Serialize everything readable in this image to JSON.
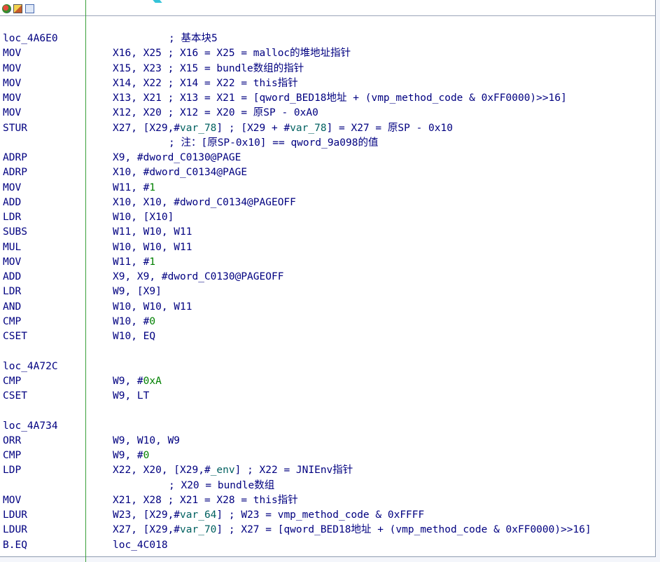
{
  "toolbar": {
    "icons": [
      "graph-view-icon",
      "edit-icon",
      "save-view-icon"
    ]
  },
  "colors": {
    "code_text": "#000080",
    "immediate": "#008000",
    "variable": "#006060",
    "separator_line": "#3aa03a"
  },
  "lines": [
    {
      "kind": "label",
      "text": "loc_4A6E0",
      "comment": "; 基本块5"
    },
    {
      "kind": "insn",
      "mnem": "MOV",
      "parts": [
        {
          "t": "X16, X25 ; X16 = X25 = malloc的堆地址指针"
        }
      ]
    },
    {
      "kind": "insn",
      "mnem": "MOV",
      "parts": [
        {
          "t": "X15, X23 ; X15 = bundle数组的指针"
        }
      ]
    },
    {
      "kind": "insn",
      "mnem": "MOV",
      "parts": [
        {
          "t": "X14, X22 ; X14 = X22 = this指针"
        }
      ]
    },
    {
      "kind": "insn",
      "mnem": "MOV",
      "parts": [
        {
          "t": "X13, X21 ; X13 = X21 = [qword_BED18地址 + (vmp_method_code & 0xFF0000)>>16]"
        }
      ]
    },
    {
      "kind": "insn",
      "mnem": "MOV",
      "parts": [
        {
          "t": "X12, X20 ; X12 = X20 = 原SP - 0xA0"
        }
      ]
    },
    {
      "kind": "insn",
      "mnem": "STUR",
      "parts": [
        {
          "t": "X27, [X29,#"
        },
        {
          "t": "var_78",
          "c": "var"
        },
        {
          "t": "] ; [X29 + #"
        },
        {
          "t": "var_78",
          "c": "var"
        },
        {
          "t": "] = X27 = 原SP - 0x10"
        }
      ]
    },
    {
      "kind": "comment",
      "text": "; 注：[原SP-0x10] == qword_9a098的值"
    },
    {
      "kind": "insn",
      "mnem": "ADRP",
      "parts": [
        {
          "t": "X9, #dword_C0130@PAGE"
        }
      ]
    },
    {
      "kind": "insn",
      "mnem": "ADRP",
      "parts": [
        {
          "t": "X10, #dword_C0134@PAGE"
        }
      ]
    },
    {
      "kind": "insn",
      "mnem": "MOV",
      "parts": [
        {
          "t": "W11, #"
        },
        {
          "t": "1",
          "c": "num"
        }
      ]
    },
    {
      "kind": "insn",
      "mnem": "ADD",
      "parts": [
        {
          "t": "X10, X10, #dword_C0134@PAGEOFF"
        }
      ]
    },
    {
      "kind": "insn",
      "mnem": "LDR",
      "parts": [
        {
          "t": "W10, [X10]"
        }
      ]
    },
    {
      "kind": "insn",
      "mnem": "SUBS",
      "parts": [
        {
          "t": "W11, W10, W11"
        }
      ]
    },
    {
      "kind": "insn",
      "mnem": "MUL",
      "parts": [
        {
          "t": "W10, W10, W11"
        }
      ]
    },
    {
      "kind": "insn",
      "mnem": "MOV",
      "parts": [
        {
          "t": "W11, #"
        },
        {
          "t": "1",
          "c": "num"
        }
      ]
    },
    {
      "kind": "insn",
      "mnem": "ADD",
      "parts": [
        {
          "t": "X9, X9, #dword_C0130@PAGEOFF"
        }
      ]
    },
    {
      "kind": "insn",
      "mnem": "LDR",
      "parts": [
        {
          "t": "W9, [X9]"
        }
      ]
    },
    {
      "kind": "insn",
      "mnem": "AND",
      "parts": [
        {
          "t": "W10, W10, W11"
        }
      ]
    },
    {
      "kind": "insn",
      "mnem": "CMP",
      "parts": [
        {
          "t": "W10, #"
        },
        {
          "t": "0",
          "c": "num"
        }
      ]
    },
    {
      "kind": "insn",
      "mnem": "CSET",
      "parts": [
        {
          "t": "W10, EQ"
        }
      ]
    },
    {
      "kind": "blank"
    },
    {
      "kind": "label",
      "text": "loc_4A72C",
      "comment": ""
    },
    {
      "kind": "insn",
      "mnem": "CMP",
      "parts": [
        {
          "t": "W9, #"
        },
        {
          "t": "0xA",
          "c": "num"
        }
      ]
    },
    {
      "kind": "insn",
      "mnem": "CSET",
      "parts": [
        {
          "t": "W9, LT"
        }
      ]
    },
    {
      "kind": "blank"
    },
    {
      "kind": "label",
      "text": "loc_4A734",
      "comment": ""
    },
    {
      "kind": "insn",
      "mnem": "ORR",
      "parts": [
        {
          "t": "W9, W10, W9"
        }
      ]
    },
    {
      "kind": "insn",
      "mnem": "CMP",
      "parts": [
        {
          "t": "W9, #"
        },
        {
          "t": "0",
          "c": "num"
        }
      ]
    },
    {
      "kind": "insn",
      "mnem": "LDP",
      "parts": [
        {
          "t": "X22, X20, [X29,#"
        },
        {
          "t": "_env",
          "c": "var"
        },
        {
          "t": "] ; X22 = JNIEnv指针"
        }
      ]
    },
    {
      "kind": "comment",
      "text": "; X20 = bundle数组"
    },
    {
      "kind": "insn",
      "mnem": "MOV",
      "parts": [
        {
          "t": "X21, X28 ; X21 = X28 = this指针"
        }
      ]
    },
    {
      "kind": "insn",
      "mnem": "LDUR",
      "parts": [
        {
          "t": "W23, [X29,#"
        },
        {
          "t": "var_64",
          "c": "var"
        },
        {
          "t": "] ; W23 = vmp_method_code & 0xFFFF"
        }
      ]
    },
    {
      "kind": "insn",
      "mnem": "LDUR",
      "parts": [
        {
          "t": "X27, [X29,#"
        },
        {
          "t": "var_70",
          "c": "var"
        },
        {
          "t": "] ; X27 = [qword_BED18地址 + (vmp_method_code & 0xFF0000)>>16]"
        }
      ]
    },
    {
      "kind": "insn",
      "mnem": "B.EQ",
      "parts": [
        {
          "t": "loc_4C018"
        }
      ]
    }
  ]
}
